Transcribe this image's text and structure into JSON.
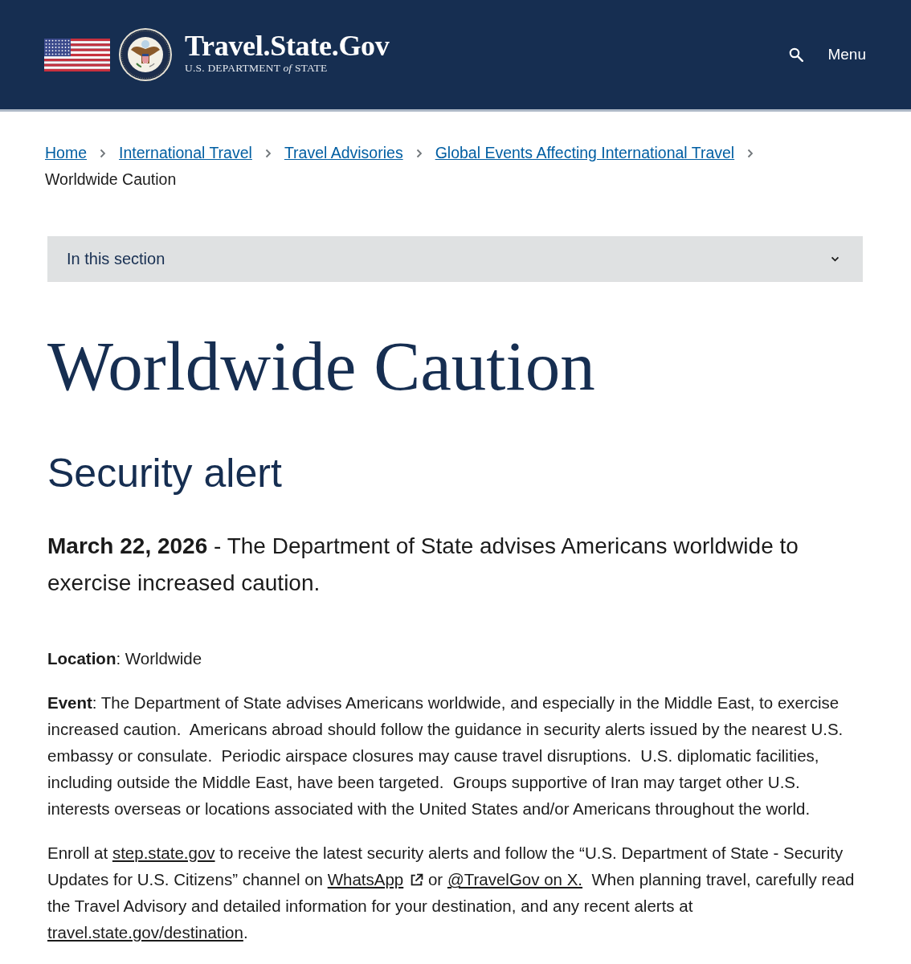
{
  "header": {
    "title": "Travel.State.Gov",
    "subtitle": "U.S. DEPARTMENT *of* STATE",
    "menu": "Menu"
  },
  "breadcrumbs": [
    {
      "label": "Home",
      "current": false
    },
    {
      "label": "International Travel",
      "current": false
    },
    {
      "label": "Travel Advisories",
      "current": false
    },
    {
      "label": "Global Events Affecting International Travel",
      "current": false
    },
    {
      "label": "Worldwide Caution",
      "current": true
    }
  ],
  "section_nav": {
    "label": "In this section",
    "expanded": false
  },
  "page_title": "Worldwide Caution",
  "alert": {
    "heading": "Security alert",
    "summary": "**March 22, 2026** - The Department of State advises Americans worldwide to exercise increased caution.",
    "location": "**Location**: Worldwide",
    "event": "**Event**: The Department of State advises Americans worldwide, and especially in the Middle East, to exercise increased caution.  Americans abroad should follow the guidance in security alerts issued by the nearest U.S. embassy or consulate.  Periodic airspace closures may cause travel disruptions.  U.S. diplomatic facilities, including outside the Middle East, have been targeted.  Groups supportive of Iran may target other U.S. interests overseas or locations associated with the United States and/or Americans throughout the world.",
    "enroll": [
      {
        "kind": "text",
        "text": "Enroll at "
      },
      {
        "kind": "link",
        "text": "step.state.gov",
        "external": false
      },
      {
        "kind": "text",
        "text": " to receive the latest security alerts and follow the “U.S. Department of State - Security Updates for U.S. Citizens” channel on "
      },
      {
        "kind": "link",
        "text": "WhatsApp",
        "external": true
      },
      {
        "kind": "text",
        "text": " or "
      },
      {
        "kind": "link",
        "text": "@TravelGov on X.",
        "external": false
      },
      {
        "kind": "text",
        "text": "  When planning travel, carefully read the Travel Advisory and detailed information for your destination, and any recent alerts at "
      },
      {
        "kind": "link",
        "text": "travel.state.gov/destination",
        "external": false
      },
      {
        "kind": "text",
        "text": "."
      }
    ]
  }
}
